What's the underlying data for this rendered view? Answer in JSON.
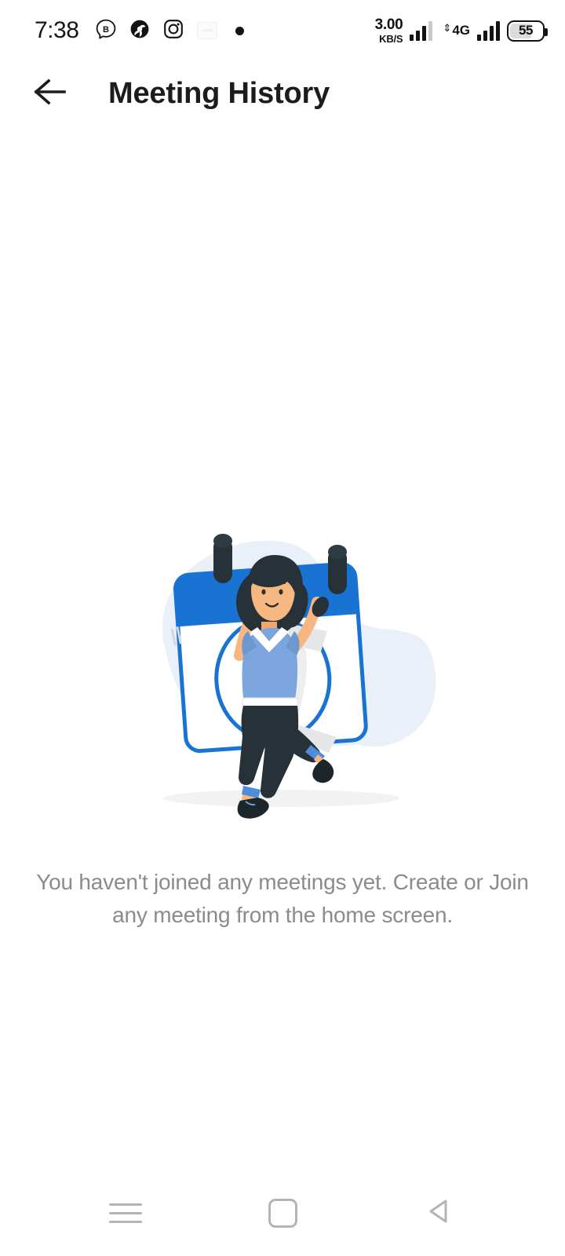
{
  "status_bar": {
    "clock": "7:38",
    "left_icons": [
      {
        "name": "messenger-b-icon",
        "label": "B"
      },
      {
        "name": "app-circle-icon",
        "label": ""
      },
      {
        "name": "instagram-icon",
        "label": ""
      },
      {
        "name": "notification-card-icon",
        "label": ""
      },
      {
        "name": "notification-dot-icon",
        "label": ""
      }
    ],
    "network_speed_value": "3.00",
    "network_speed_unit": "KB/S",
    "network_type": "4G",
    "battery_level": "55"
  },
  "app_bar": {
    "back_icon": "arrow-left-icon",
    "title": "Meeting History"
  },
  "content": {
    "illustration_name": "empty-meeting-history-illustration",
    "empty_message": "You haven't joined any meetings yet. Create or Join any meeting from the home screen."
  },
  "nav_bar": {
    "recents_label": "Recents",
    "home_label": "Home",
    "back_label": "Back"
  },
  "colors": {
    "calendar_blue": "#1873d3",
    "calendar_blue_dark": "#1565c0",
    "blob_light": "#e9f0f9",
    "shirt_blue": "#7da5dd",
    "dark_navy": "#263238",
    "skin": "#f6b880",
    "text_grey": "#8b8b8b",
    "title_black": "#1c1c1c",
    "nav_grey": "#b4b4b4"
  }
}
